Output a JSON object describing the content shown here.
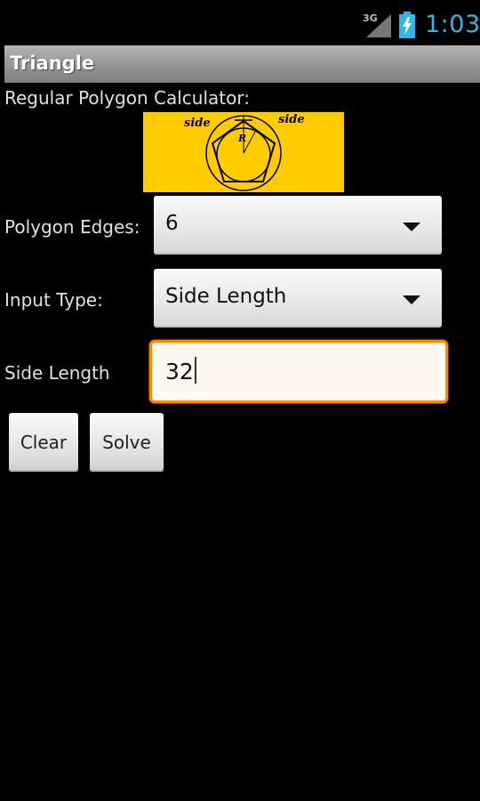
{
  "status_bar": {
    "network": "3G",
    "time": "1:03",
    "signal_icon": "cell-signal-icon",
    "battery_icon": "battery-charging-icon",
    "clock_color": "#33b5e5"
  },
  "app": {
    "title": "Triangle",
    "subtitle": "Regular Polygon Calculator:"
  },
  "diagram": {
    "side_left": "side",
    "side_right": "side",
    "radius_label": "R",
    "background": "#ffcc00"
  },
  "form": {
    "edges": {
      "label": "Polygon Edges:",
      "value": "6"
    },
    "input_type": {
      "label": "Input Type:",
      "value": "Side Length"
    },
    "side_length": {
      "label": "Side Length",
      "value": "32"
    }
  },
  "actions": {
    "clear": "Clear",
    "solve": "Solve"
  },
  "accent_color": "#ff8a00"
}
